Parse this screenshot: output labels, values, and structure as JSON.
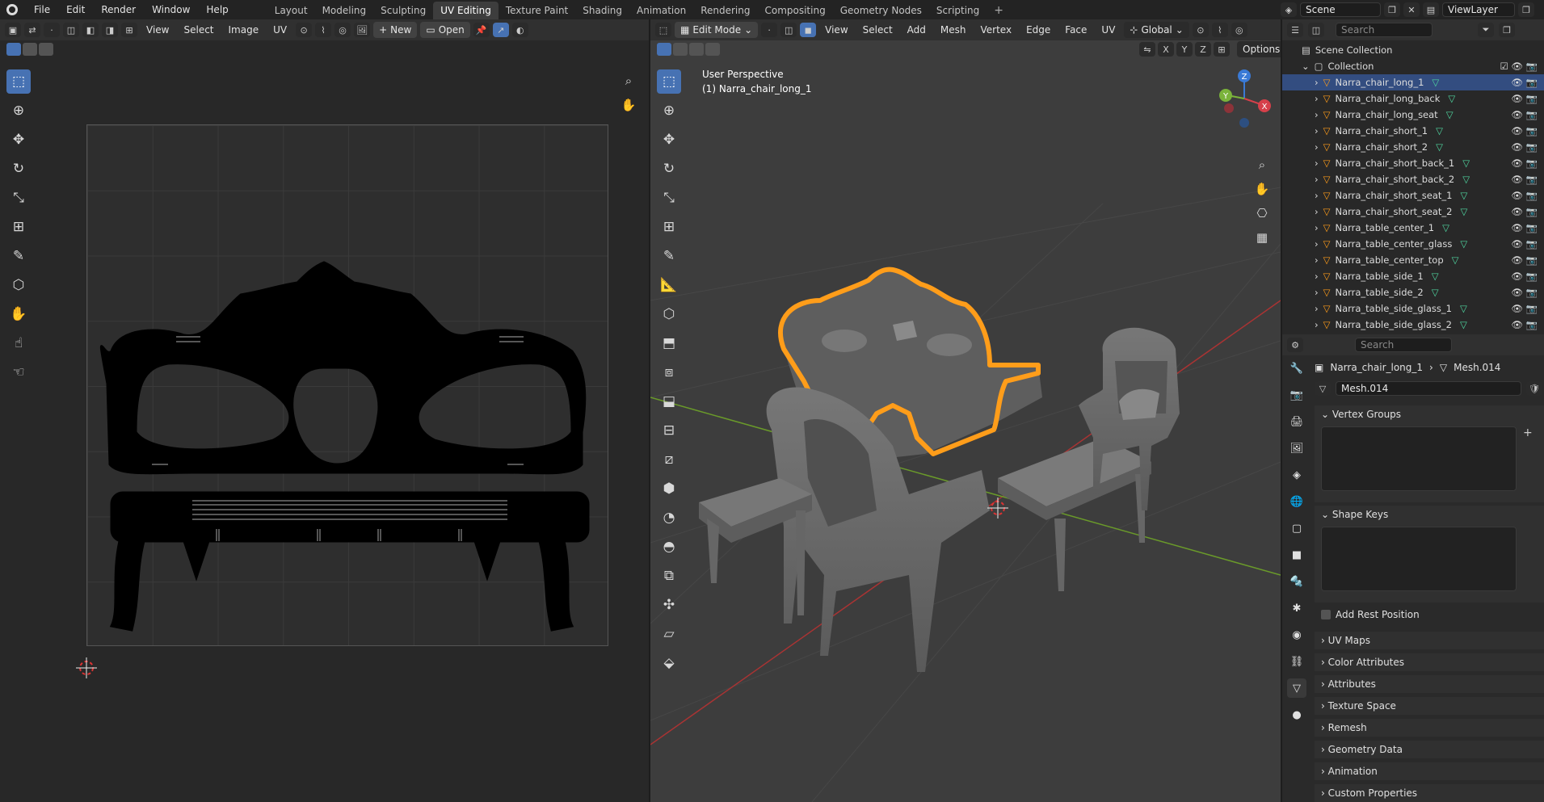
{
  "app": {
    "name": "Blender",
    "menu": [
      "File",
      "Edit",
      "Render",
      "Window",
      "Help"
    ]
  },
  "workspaces": [
    "Layout",
    "Modeling",
    "Sculpting",
    "UV Editing",
    "Texture Paint",
    "Shading",
    "Animation",
    "Rendering",
    "Compositing",
    "Geometry Nodes",
    "Scripting"
  ],
  "active_workspace": "UV Editing",
  "plus_label": "+",
  "scene": {
    "name": "Scene",
    "view_layer": "ViewLayer"
  },
  "uv_editor": {
    "menus": [
      "View",
      "Select",
      "Image",
      "UV"
    ],
    "new_label": "New",
    "open_label": "Open",
    "tools": [
      "select-box",
      "cursor",
      "move",
      "rotate",
      "scale",
      "transform",
      "annotate",
      "rip",
      "grab",
      "relax",
      "pinch"
    ]
  },
  "viewport": {
    "mode": "Edit Mode",
    "menus": [
      "View",
      "Select",
      "Add",
      "Mesh",
      "Vertex",
      "Edge",
      "Face",
      "UV"
    ],
    "transform_orientation": "Global",
    "axes": [
      "X",
      "Y",
      "Z"
    ],
    "options_label": "Options",
    "overlay_title": "User Perspective",
    "overlay_object": "(1) Narra_chair_long_1",
    "gizmo": {
      "x": "X",
      "y": "Y",
      "z": "Z"
    }
  },
  "outliner": {
    "search_placeholder": "Search",
    "scene_collection": "Scene Collection",
    "collection": "Collection",
    "items": [
      "Narra_chair_long_1",
      "Narra_chair_long_back",
      "Narra_chair_long_seat",
      "Narra_chair_short_1",
      "Narra_chair_short_2",
      "Narra_chair_short_back_1",
      "Narra_chair_short_back_2",
      "Narra_chair_short_seat_1",
      "Narra_chair_short_seat_2",
      "Narra_table_center_1",
      "Narra_table_center_glass",
      "Narra_table_center_top",
      "Narra_table_side_1",
      "Narra_table_side_2",
      "Narra_table_side_glass_1",
      "Narra_table_side_glass_2"
    ],
    "selected": "Narra_chair_long_1"
  },
  "properties": {
    "search_placeholder": "Search",
    "breadcrumb_object": "Narra_chair_long_1",
    "breadcrumb_mesh": "Mesh.014",
    "mesh_name": "Mesh.014",
    "vertex_groups": "Vertex Groups",
    "shape_keys": "Shape Keys",
    "add_rest_position": "Add Rest Position",
    "collapsed": [
      "UV Maps",
      "Color Attributes",
      "Attributes",
      "Texture Space",
      "Remesh",
      "Geometry Data",
      "Animation",
      "Custom Properties"
    ]
  },
  "colors": {
    "accent": "#4772b3",
    "selection_orange": "#ff9d1a",
    "header": "#303030",
    "panel": "#282828"
  }
}
